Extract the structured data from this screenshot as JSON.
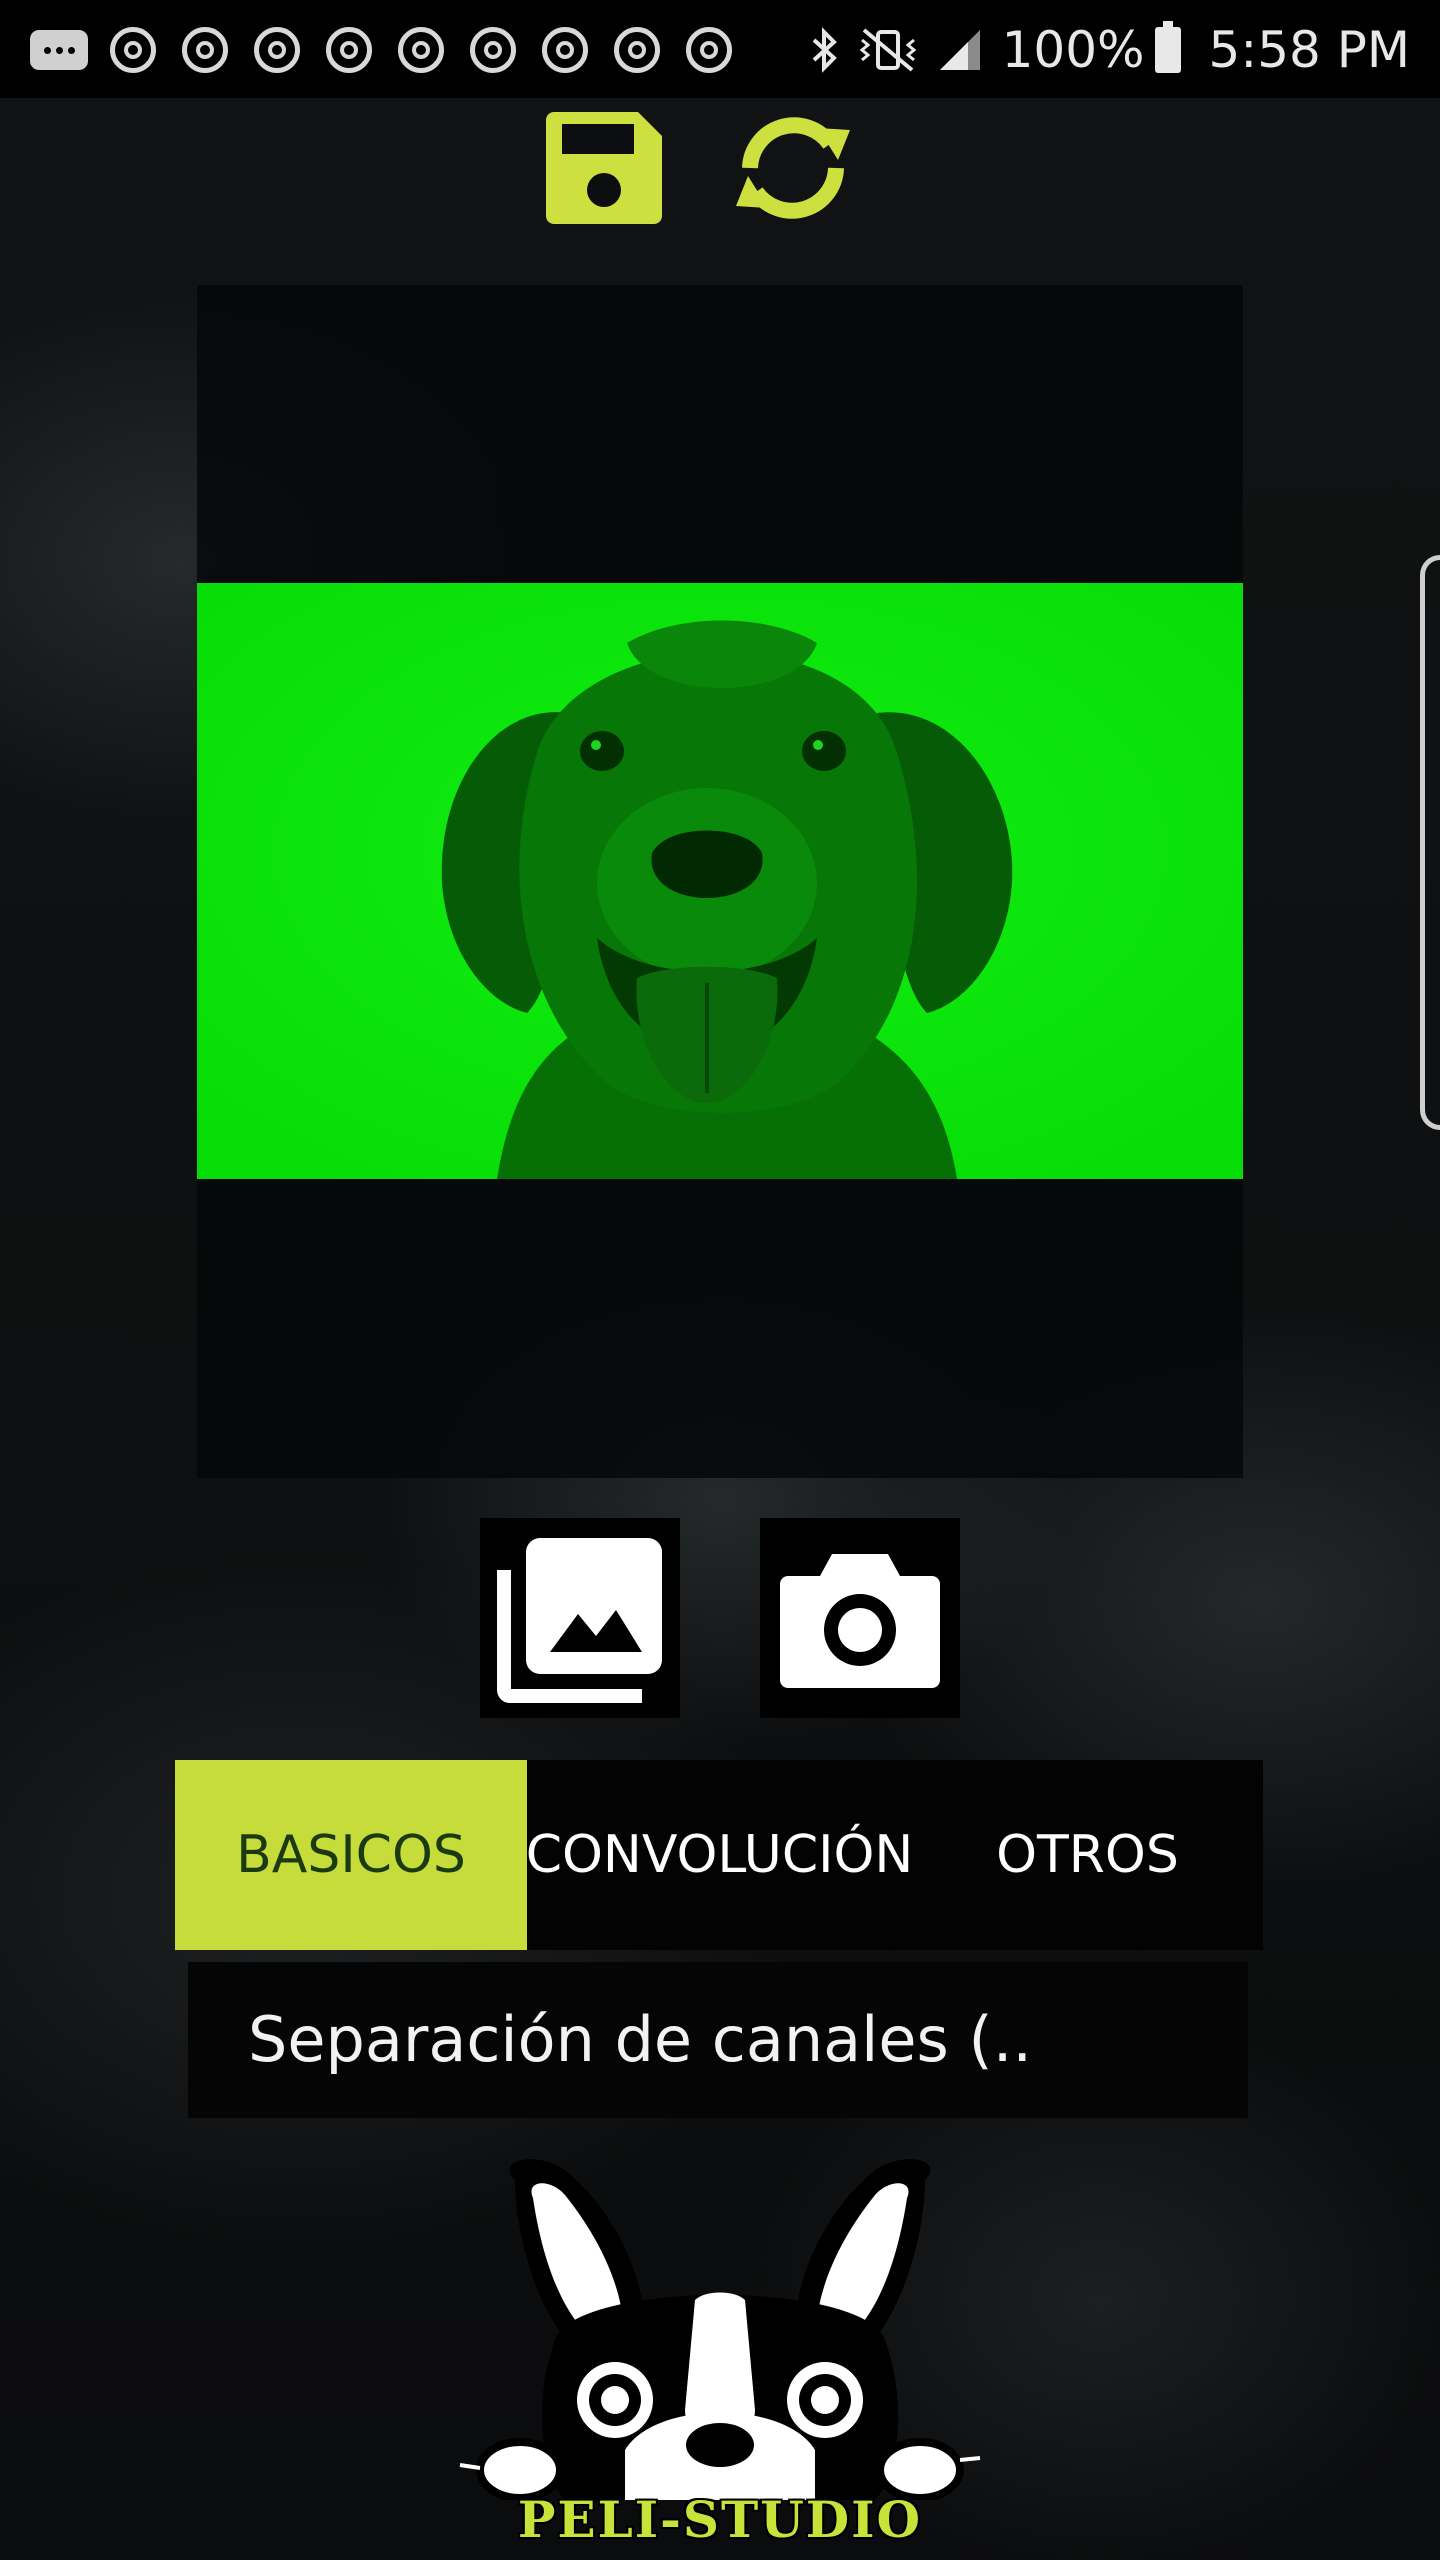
{
  "status_bar": {
    "battery": "100%",
    "time": "5:58 PM",
    "icons": [
      "notification-dots-icon",
      "chrome-icon",
      "bluetooth-icon",
      "vibrate-mute-icon",
      "signal-icon",
      "battery-icon"
    ]
  },
  "toolbar": {
    "save_icon": "save-floppy-icon",
    "refresh_icon": "refresh-sync-icon",
    "accent_color": "#cde03f"
  },
  "image": {
    "filter_tint": "#08e808"
  },
  "source_buttons": {
    "gallery_icon": "gallery-images-icon",
    "camera_icon": "camera-icon"
  },
  "tabs": [
    {
      "label": "BASICOS",
      "active": true
    },
    {
      "label": "CONVOLUCIÓN",
      "active": false
    },
    {
      "label": "OTROS",
      "active": false
    }
  ],
  "filter_select": {
    "selected": "Separación de canales (.."
  },
  "logo": {
    "text": "PELI-STUDIO"
  }
}
